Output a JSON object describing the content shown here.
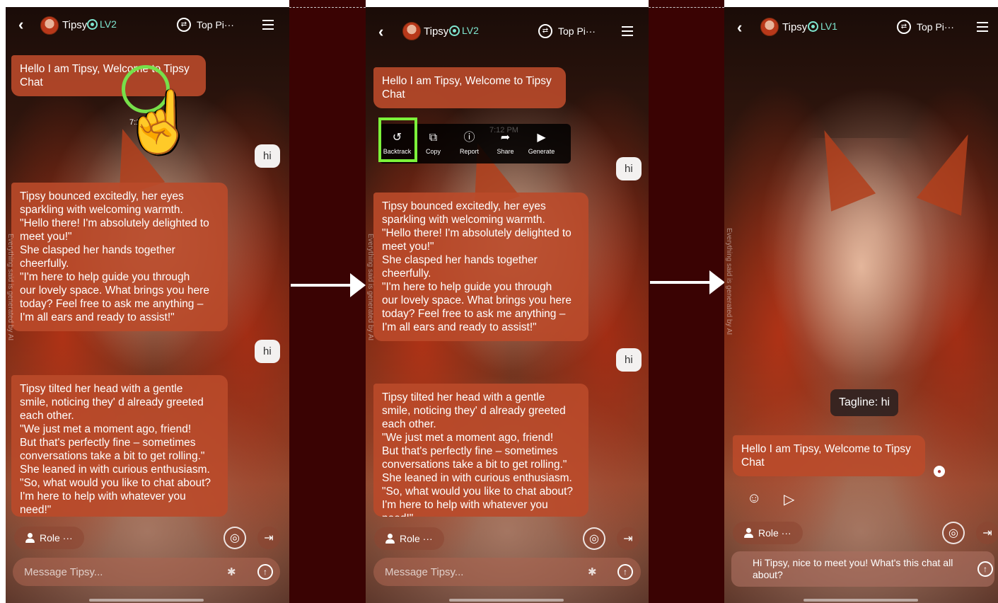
{
  "colors": {
    "divider": "#3a0303",
    "bot_bubble": "#ba4a2a",
    "level_accent": "#7fe6d0",
    "highlight": "#7cf23a"
  },
  "panels": [
    {
      "header": {
        "name": "Tipsy",
        "level": "LV2",
        "top_label": "Top Pi···"
      },
      "greeting": "Hello I am Tipsy, Welcome to Tipsy\nChat",
      "time_fragment": "7:1",
      "user_messages": [
        "hi",
        "hi"
      ],
      "bot_messages": [
        "Tipsy bounced excitedly, her eyes\nsparkling with welcoming warmth.\n\"Hello there! I'm absolutely delighted to\nmeet you!\"\nShe clasped her hands together\ncheerfully.\n\"I'm here to help guide you through\nour lovely space. What brings you here\ntoday? Feel free to ask me anything –\nI'm all ears and ready to assist!\"",
        "Tipsy tilted her head with a gentle\nsmile, noticing they' d already greeted\neach other.\n\"We just met a moment ago, friend!\nBut that's perfectly fine – sometimes\nconversations take a bit to get rolling.\"\nShe leaned in with curious enthusiasm.\n\"So, what would you like to chat about?\nI'm here to help with whatever you\nneed!\""
      ],
      "side_note": "Everything said is generated by AI",
      "role_label": "Role ···",
      "message_placeholder": "Message Tipsy..."
    },
    {
      "header": {
        "name": "Tipsy",
        "level": "LV2",
        "top_label": "Top Pi···"
      },
      "greeting": "Hello I am Tipsy, Welcome to Tipsy\nChat",
      "timestamp": "7:12 PM",
      "toolbar": [
        "Backtrack",
        "Copy",
        "Report",
        "Share",
        "Generate"
      ],
      "user_messages": [
        "hi",
        "hi"
      ],
      "bot_messages": [
        "Tipsy bounced excitedly, her eyes\nsparkling with welcoming warmth.\n\"Hello there! I'm absolutely delighted to\nmeet you!\"\nShe clasped her hands together\ncheerfully.\n\"I'm here to help guide you through\nour lovely space. What brings you here\ntoday? Feel free to ask me anything –\nI'm all ears and ready to assist!\"",
        "Tipsy tilted her head with a gentle\nsmile, noticing they' d already greeted\neach other.\n\"We just met a moment ago, friend!\nBut that's perfectly fine – sometimes\nconversations take a bit to get rolling.\"\nShe leaned in with curious enthusiasm.\n\"So, what would you like to chat about?\nI'm here to help with whatever you\nneed!\""
      ],
      "side_note": "Everything said is generated by AI",
      "role_label": "Role ···",
      "message_placeholder": "Message Tipsy..."
    },
    {
      "header": {
        "name": "Tipsy",
        "level": "LV1",
        "top_label": "Top Pi···"
      },
      "tagline": "Tagline: hi",
      "greeting": "Hello I am Tipsy, Welcome to Tipsy\nChat",
      "side_note": "Everything said is generated by AI",
      "role_label": "Role ···",
      "suggestion": "Hi Tipsy, nice to meet you! What's this chat all\nabout?"
    }
  ]
}
